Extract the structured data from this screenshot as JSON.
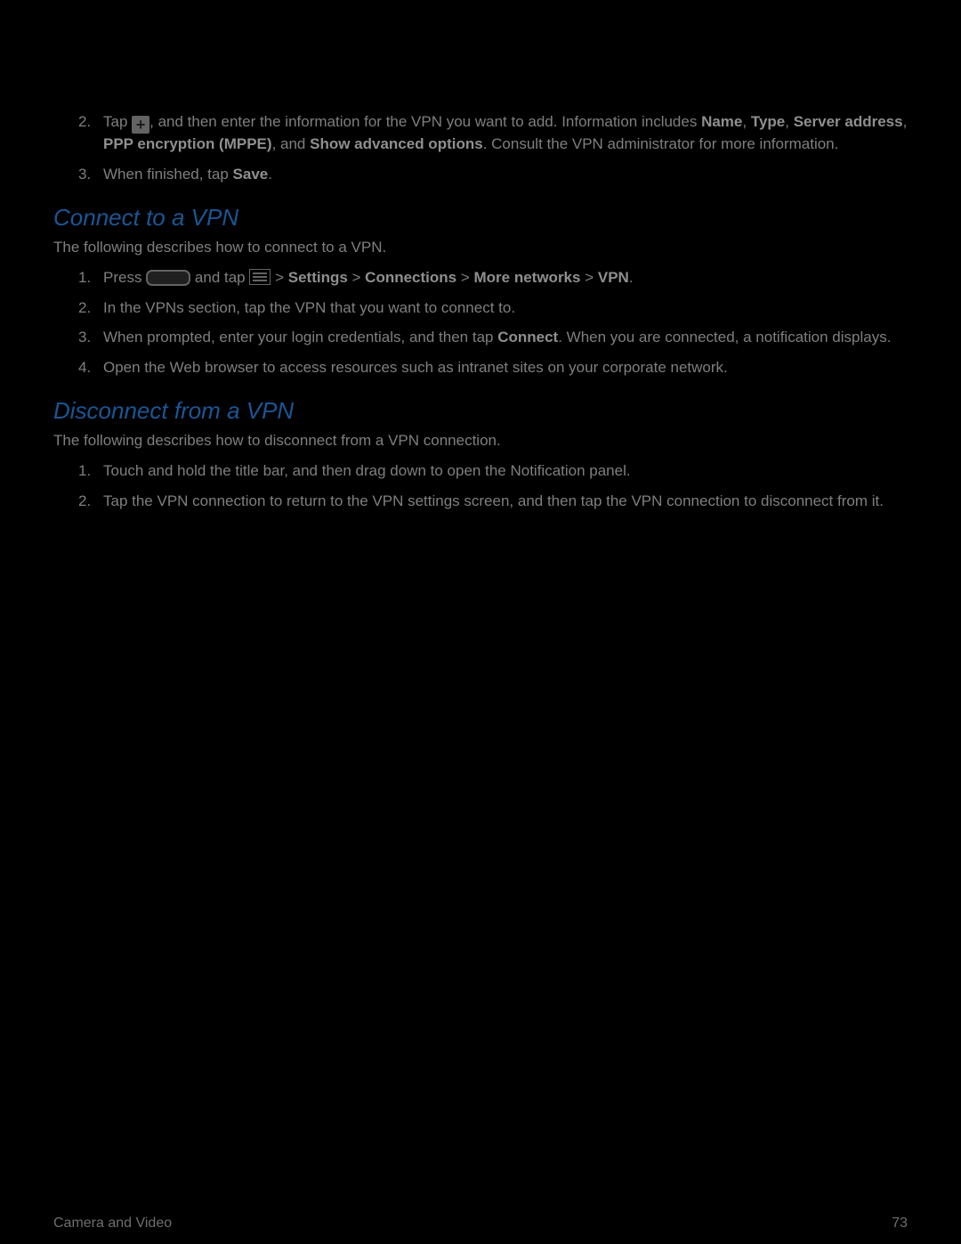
{
  "intro": {
    "item2": {
      "num": "2.",
      "seg_a": "Tap ",
      "seg_b": ", and then enter the information for the VPN you want to add. Information includes ",
      "b1": "Name",
      "comma1": ", ",
      "b2": "Type",
      "comma2": ", ",
      "b3": "Server address",
      "comma3": ", ",
      "b4": "PPP encryption (MPPE)",
      "comma4": ", and ",
      "b5": "Show advanced options",
      "seg_c": ". Consult the VPN administrator for more information."
    },
    "item3": {
      "num": "3.",
      "seg_a": "When finished, tap ",
      "b1": "Save",
      "seg_b": "."
    }
  },
  "connect": {
    "heading": "Connect to a VPN",
    "intro": "The following describes how to connect to a VPN.",
    "item1": {
      "num": "1.",
      "seg_a": "Press ",
      "seg_b": " and tap ",
      "seg_c": " > ",
      "b1": "Settings",
      "sep1": " > ",
      "b2": "Connections",
      "sep2": " > ",
      "b3": "More networks",
      "sep3": " > ",
      "b4": "VPN",
      "seg_d": "."
    },
    "item2": {
      "num": "2.",
      "text": "In the VPNs section, tap the VPN that you want to connect to."
    },
    "item3": {
      "num": "3.",
      "seg_a": "When prompted, enter your login credentials, and then tap ",
      "b1": "Connect",
      "seg_b": ". When you are connected, a notification displays."
    },
    "item4": {
      "num": "4.",
      "text": "Open the Web browser to access resources such as intranet sites on your corporate network."
    }
  },
  "disconnect": {
    "heading": "Disconnect from a VPN",
    "intro": "The following describes how to disconnect from a VPN connection.",
    "item1": {
      "num": "1.",
      "text": "Touch and hold the title bar, and then drag down to open the Notification panel."
    },
    "item2": {
      "num": "2.",
      "text": "Tap the VPN connection to return to the VPN settings screen, and then tap the VPN connection to disconnect from it."
    }
  },
  "footer": {
    "section": "Camera and Video",
    "page": "73"
  }
}
